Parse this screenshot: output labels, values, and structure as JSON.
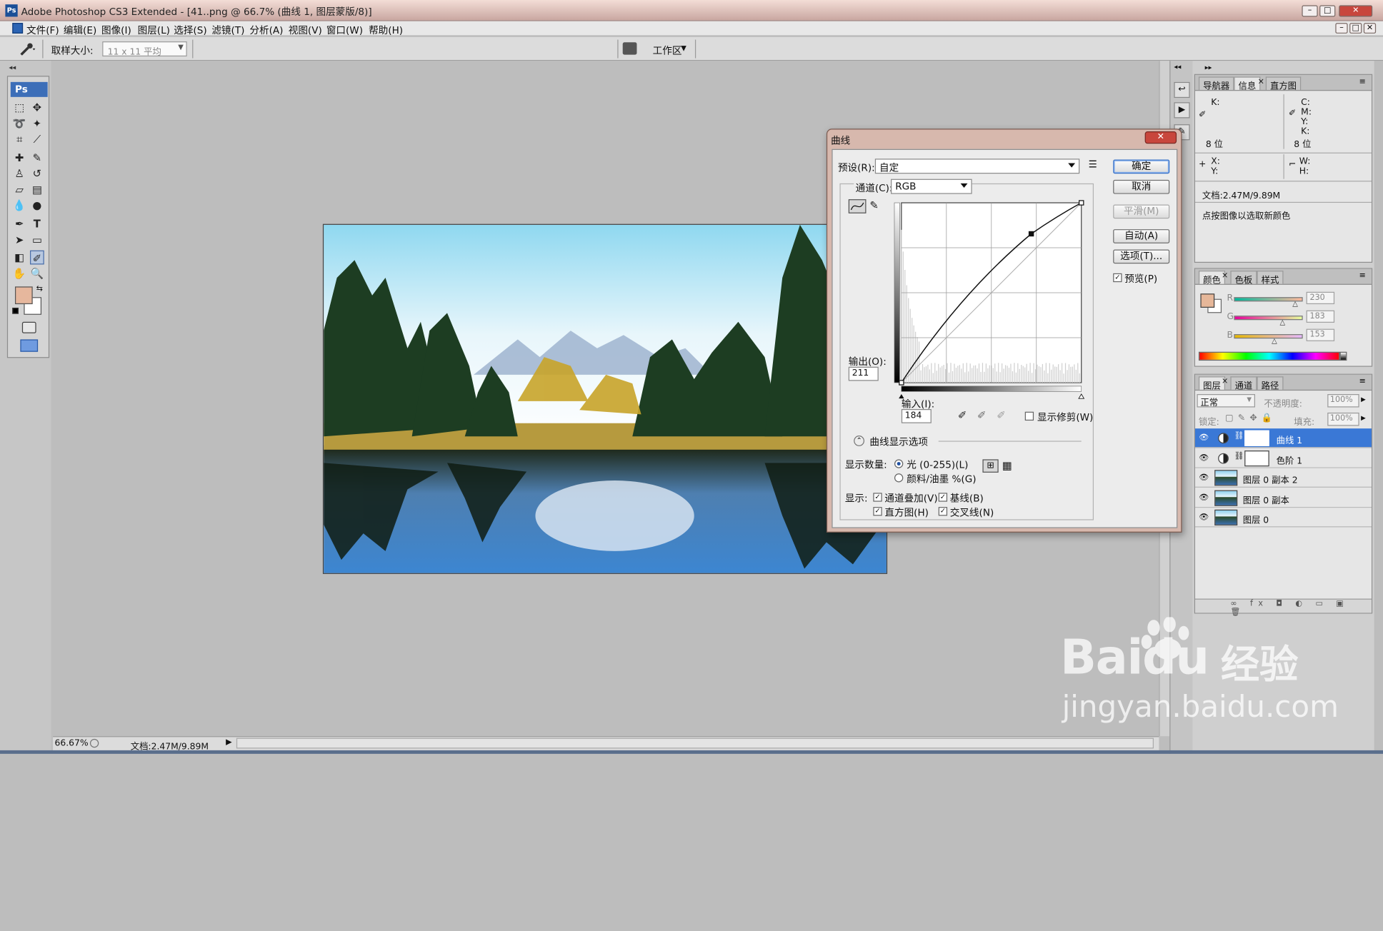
{
  "window": {
    "title": "Adobe Photoshop CS3 Extended - [41..png @ 66.7% (曲线 1, 图层蒙版/8)]",
    "app_icon": "Ps"
  },
  "menu": [
    "文件(F)",
    "编辑(E)",
    "图像(I)",
    "图层(L)",
    "选择(S)",
    "滤镜(T)",
    "分析(A)",
    "视图(V)",
    "窗口(W)",
    "帮助(H)"
  ],
  "options": {
    "sample_label": "取样大小:",
    "sample_value": "11 x 11 平均",
    "workspace": "工作区"
  },
  "toolbox": {
    "logo": "Ps",
    "fg_color": "#e6b79d",
    "bg_color": "#ffffff"
  },
  "status": {
    "zoom": "66.67%",
    "doc": "文档:2.47M/9.89M"
  },
  "info_panel": {
    "tabs": [
      "导航器",
      "信息",
      "直方图"
    ],
    "k_label": "K:",
    "c": "C:",
    "m": "M:",
    "y": "Y:",
    "k": "K:",
    "bits_left": "8 位",
    "bits_right": "8 位",
    "x": "X:",
    "y2": "Y:",
    "w": "W:",
    "h": "H:",
    "doc": "文档:2.47M/9.89M",
    "hint": "点按图像以选取新颜色"
  },
  "color_panel": {
    "tabs": [
      "颜色",
      "色板",
      "样式"
    ],
    "r_label": "R",
    "g_label": "G",
    "b_label": "B",
    "r": "230",
    "g": "183",
    "b": "153",
    "r_level": 0.902,
    "g_level": 0.718,
    "b_level": 0.6,
    "swatch": "#e6b799"
  },
  "layers_panel": {
    "tabs": [
      "图层",
      "通道",
      "路径"
    ],
    "blend": "正常",
    "opacity_label": "不透明度:",
    "opacity": "100%",
    "lock_label": "锁定:",
    "fill_label": "填充:",
    "fill": "100%",
    "layers": [
      {
        "name": "曲线 1",
        "selected": true,
        "adjust": true
      },
      {
        "name": "色阶 1",
        "selected": false,
        "adjust": true
      },
      {
        "name": "图层 0 副本 2",
        "selected": false,
        "adjust": false
      },
      {
        "name": "图层 0 副本",
        "selected": false,
        "adjust": false
      },
      {
        "name": "图层 0",
        "selected": false,
        "adjust": false
      }
    ]
  },
  "curves": {
    "title": "曲线",
    "preset_label": "预设(R):",
    "preset": "自定",
    "channel_label": "通道(C):",
    "channel": "RGB",
    "ok": "确定",
    "cancel": "取消",
    "smooth": "平滑(M)",
    "auto": "自动(A)",
    "options": "选项(T)...",
    "preview": "预览(P)",
    "output_label": "输出(O):",
    "output": "211",
    "input_label": "输入(I):",
    "input": "184",
    "clip": "显示修剪(W)",
    "display_options": "曲线显示选项",
    "amount_label": "显示数量:",
    "light": "光 (0-255)(L)",
    "pigment": "颜料/油墨 %(G)",
    "show_label": "显示:",
    "ch_overlay": "通道叠加(V)",
    "baseline": "基线(B)",
    "histogram": "直方图(H)",
    "intersect": "交叉线(N)",
    "control_points": [
      [
        0,
        0
      ],
      [
        184,
        211
      ],
      [
        255,
        255
      ]
    ]
  },
  "watermark": {
    "brand": "Baidu",
    "cn": "经验",
    "url": "jingyan.baidu.com"
  }
}
